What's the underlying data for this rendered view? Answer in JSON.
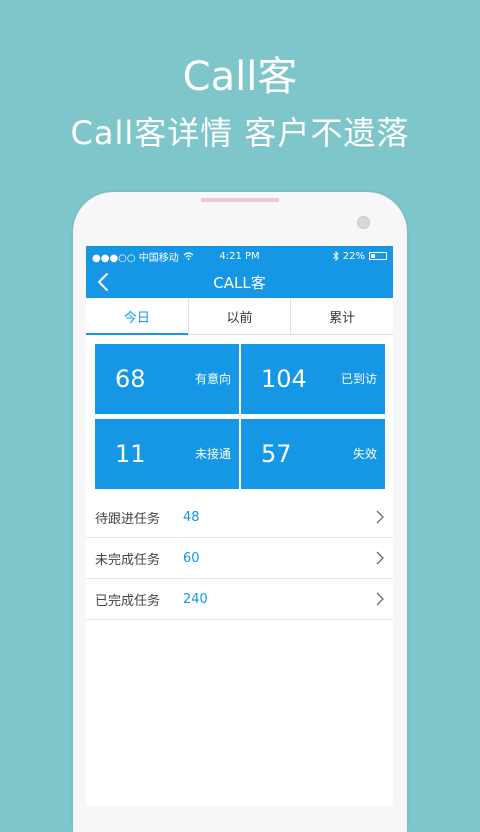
{
  "promo": {
    "title": "Call客",
    "subtitle": "Call客详情  客户不遗落"
  },
  "statusbar": {
    "carrier": "●●●○○ 中国移动",
    "time": "4:21 PM",
    "battery": "22%"
  },
  "navbar": {
    "title": "CALL客"
  },
  "tabs": [
    {
      "label": "今日",
      "active": true
    },
    {
      "label": "以前",
      "active": false
    },
    {
      "label": "累计",
      "active": false
    }
  ],
  "stats": [
    {
      "value": "68",
      "label": "有意向"
    },
    {
      "value": "104",
      "label": "已到访"
    },
    {
      "value": "11",
      "label": "未接通"
    },
    {
      "value": "57",
      "label": "失效"
    }
  ],
  "tasks": [
    {
      "label": "待跟进任务",
      "value": "48"
    },
    {
      "label": "未完成任务",
      "value": "60"
    },
    {
      "label": "已完成任务",
      "value": "240"
    }
  ],
  "colors": {
    "background": "#7fc6cb",
    "accent": "#1597e5"
  }
}
